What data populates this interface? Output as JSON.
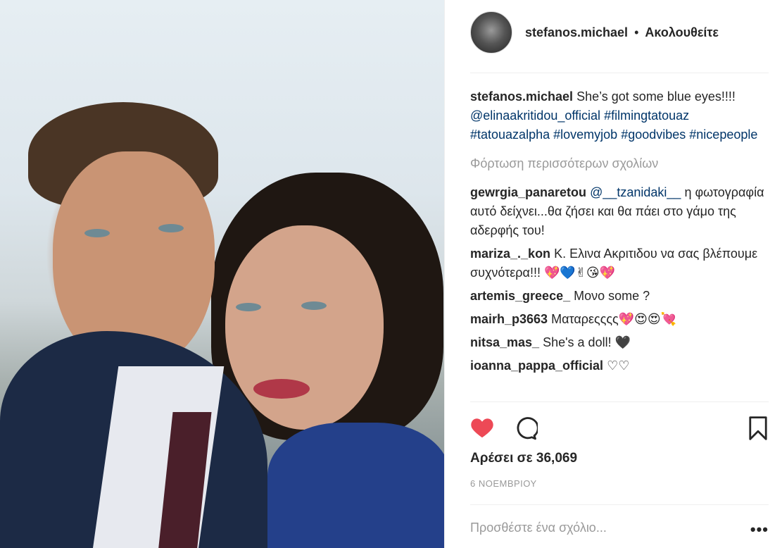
{
  "header": {
    "username": "stefanos.michael",
    "separator": "•",
    "follow_label": "Ακολουθείτε"
  },
  "caption": {
    "username": "stefanos.michael",
    "text": "She’s got some blue eyes!!!!",
    "mention": "@elinaakritidou_official",
    "hashtags": [
      "#filmingtatouaz",
      "#tatouazalpha",
      "#lovemyjob",
      "#goodvibes",
      "#nicepeople"
    ]
  },
  "load_more": "Φόρτωση περισσότερων σχολίων",
  "comments": [
    {
      "username": "gewrgia_panaretou",
      "mention": "@__tzanidaki__",
      "text": "η φωτογραφία αυτό δείχνει...θα ζήσει και θα πάει στο γάμο της αδερφής του!"
    },
    {
      "username": "mariza_._kon",
      "mention": "",
      "text": "Κ. Ελινα Ακριτιδου να σας βλέπουμε συχνότερα!!! 💖💙✌😘💖"
    },
    {
      "username": "artemis_greece_",
      "mention": "",
      "text": "Μονο some ?"
    },
    {
      "username": "mairh_p3663",
      "mention": "",
      "text": "Ματαρεςςςς💖😍😍💘"
    },
    {
      "username": "nitsa_mas_",
      "mention": "",
      "text": "She's a doll! 🖤"
    },
    {
      "username": "ioanna_pappa_official",
      "mention": "",
      "text": "♡♡"
    }
  ],
  "likes": "Αρέσει σε 36,069",
  "date": "6 ΝΟΕΜΒΡΙΟΥ",
  "add_comment_placeholder": "Προσθέστε ένα σχόλιο...",
  "more_options": "•••",
  "colors": {
    "link": "#003569",
    "heart": "#ed4956",
    "muted": "#999999"
  },
  "icons": [
    "heart-icon",
    "comment-icon",
    "bookmark-icon",
    "more-icon"
  ]
}
